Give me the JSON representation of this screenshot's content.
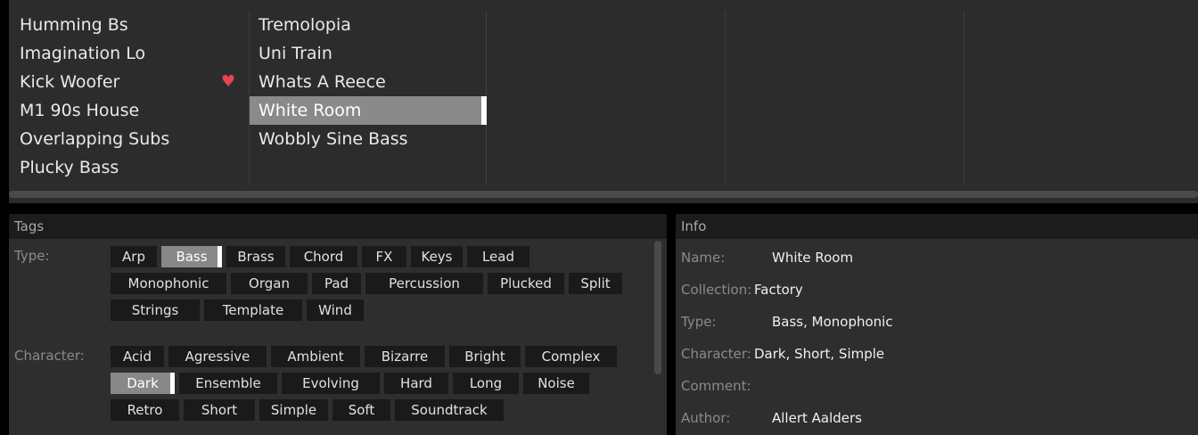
{
  "browser": {
    "column1": [
      {
        "label": "Humming Bs",
        "favorite": false
      },
      {
        "label": "Imagination Lo",
        "favorite": false
      },
      {
        "label": "Kick Woofer",
        "favorite": true
      },
      {
        "label": "M1 90s House",
        "favorite": false
      },
      {
        "label": "Overlapping Subs",
        "favorite": false
      },
      {
        "label": "Plucky Bass",
        "favorite": false
      }
    ],
    "column2": [
      {
        "label": "Tremolopia",
        "selected": false
      },
      {
        "label": "Uni Train",
        "selected": false
      },
      {
        "label": "Whats A Reece",
        "selected": false
      },
      {
        "label": "White Room",
        "selected": true
      },
      {
        "label": "Wobbly Sine Bass",
        "selected": false
      }
    ],
    "heart_icon": "heart-icon",
    "favorite_color": "#e8434e"
  },
  "tags": {
    "title": "Tags",
    "type_label": "Type:",
    "type_tags": [
      {
        "label": "Arp",
        "active": false
      },
      {
        "label": "Bass",
        "active": true
      },
      {
        "label": "Brass",
        "active": false
      },
      {
        "label": "Chord",
        "active": false
      },
      {
        "label": "FX",
        "active": false
      },
      {
        "label": "Keys",
        "active": false
      },
      {
        "label": "Lead",
        "active": false
      },
      {
        "label": "Monophonic",
        "active": false
      },
      {
        "label": "Organ",
        "active": false
      },
      {
        "label": "Pad",
        "active": false
      },
      {
        "label": "Percussion",
        "active": false
      },
      {
        "label": "Plucked",
        "active": false
      },
      {
        "label": "Split",
        "active": false
      },
      {
        "label": "Strings",
        "active": false
      },
      {
        "label": "Template",
        "active": false
      },
      {
        "label": "Wind",
        "active": false
      }
    ],
    "character_label": "Character:",
    "character_tags": [
      {
        "label": "Acid",
        "active": false
      },
      {
        "label": "Agressive",
        "active": false
      },
      {
        "label": "Ambient",
        "active": false
      },
      {
        "label": "Bizarre",
        "active": false
      },
      {
        "label": "Bright",
        "active": false
      },
      {
        "label": "Complex",
        "active": false
      },
      {
        "label": "Dark",
        "active": true
      },
      {
        "label": "Ensemble",
        "active": false
      },
      {
        "label": "Evolving",
        "active": false
      },
      {
        "label": "Hard",
        "active": false
      },
      {
        "label": "Long",
        "active": false
      },
      {
        "label": "Noise",
        "active": false
      },
      {
        "label": "Retro",
        "active": false
      },
      {
        "label": "Short",
        "active": false
      },
      {
        "label": "Simple",
        "active": false
      },
      {
        "label": "Soft",
        "active": false
      },
      {
        "label": "Soundtrack",
        "active": false
      }
    ]
  },
  "info": {
    "title": "Info",
    "fields": [
      {
        "label": "Name:",
        "value": "White Room"
      },
      {
        "label": "Collection:",
        "value": "Factory"
      },
      {
        "label": "Type:",
        "value": "Bass, Monophonic"
      },
      {
        "label": "Character:",
        "value": "Dark, Short, Simple"
      },
      {
        "label": "Comment:",
        "value": ""
      },
      {
        "label": "Author:",
        "value": "Allert Aalders"
      }
    ]
  }
}
